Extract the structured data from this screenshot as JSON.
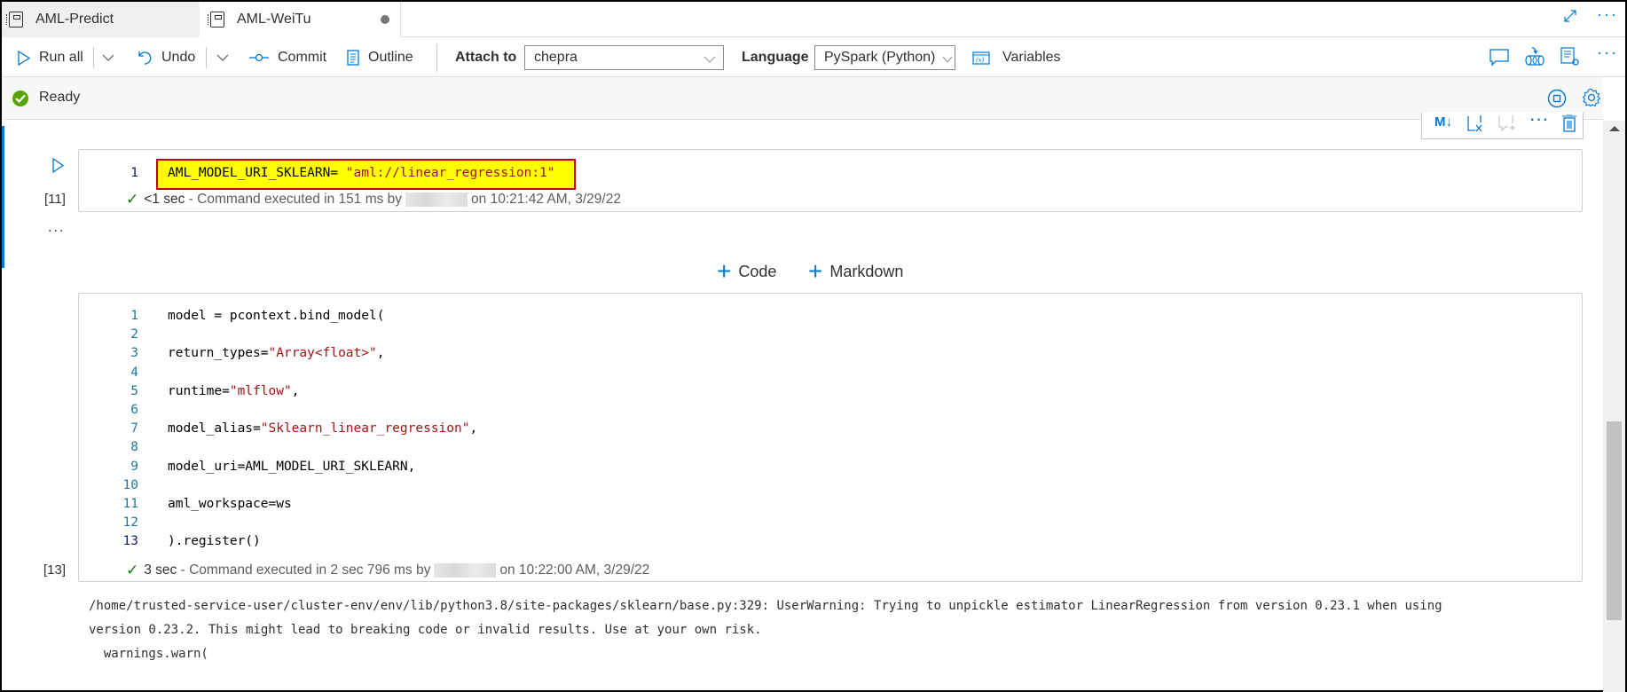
{
  "tabs": [
    {
      "label": "AML-Predict",
      "active": false,
      "icon": "notebook-icon"
    },
    {
      "label": "AML-WeiTu",
      "active": true,
      "icon": "notebook-icon",
      "unsaved": true
    }
  ],
  "tabbar_actions": {
    "expand": "expand-icon",
    "more": "more-icon"
  },
  "toolbar": {
    "run_all": "Run all",
    "undo": "Undo",
    "commit": "Commit",
    "outline": "Outline",
    "attach_to_label": "Attach to",
    "attach_to_value": "chepra",
    "language_label": "Language",
    "language_value": "PySpark (Python)",
    "variables": "Variables"
  },
  "status": {
    "text": "Ready",
    "color": "#57a300"
  },
  "cells": [
    {
      "exec_count": "[11]",
      "lines": [
        {
          "num": "1",
          "code": "AML_MODEL_URI_SKLEARN= ",
          "string": "\"aml://linear_regression:1\"",
          "highlighted": true
        }
      ],
      "status_duration": "<1 sec",
      "status_msg": "- Command executed in 151 ms by",
      "status_time": "on 10:21:42 AM, 3/29/22"
    },
    {
      "exec_count": "[13]",
      "lines": [
        {
          "num": "1",
          "code": "model = pcontext.bind_model(",
          "string": "",
          "tail": ""
        },
        {
          "num": "2",
          "code": "",
          "string": "",
          "tail": ""
        },
        {
          "num": "3",
          "code": "return_types=",
          "string": "\"Array<float>\"",
          "tail": ","
        },
        {
          "num": "4",
          "code": "",
          "string": "",
          "tail": ""
        },
        {
          "num": "5",
          "code": "runtime=",
          "string": "\"mlflow\"",
          "tail": ","
        },
        {
          "num": "6",
          "code": "",
          "string": "",
          "tail": ""
        },
        {
          "num": "7",
          "code": "model_alias=",
          "string": "\"Sklearn_linear_regression\"",
          "tail": ","
        },
        {
          "num": "8",
          "code": "",
          "string": "",
          "tail": ""
        },
        {
          "num": "9",
          "code": "model_uri=AML_MODEL_URI_SKLEARN,",
          "string": "",
          "tail": ""
        },
        {
          "num": "10",
          "code": "",
          "string": "",
          "tail": ""
        },
        {
          "num": "11",
          "code": "aml_workspace=ws",
          "string": "",
          "tail": ""
        },
        {
          "num": "12",
          "code": "",
          "string": "",
          "tail": ""
        },
        {
          "num": "13",
          "code": ").register()",
          "string": "",
          "tail": ""
        }
      ],
      "status_duration": "3 sec",
      "status_msg": "- Command executed in 2 sec 796 ms by",
      "status_time": "on 10:22:00 AM, 3/29/22",
      "output": [
        "/home/trusted-service-user/cluster-env/env/lib/python3.8/site-packages/sklearn/base.py:329: UserWarning: Trying to unpickle estimator LinearRegression from version 0.23.1 when using",
        "version 0.23.2. This might lead to breaking code or invalid results. Use at your own risk.",
        "  warnings.warn("
      ]
    }
  ],
  "more_ellipsis": "...",
  "add_cell": {
    "code": "Code",
    "markdown": "Markdown"
  },
  "colors": {
    "accent": "#0078d4",
    "string": "#a31515",
    "highlight": "#ffff00",
    "highlight_border": "#c00000"
  }
}
